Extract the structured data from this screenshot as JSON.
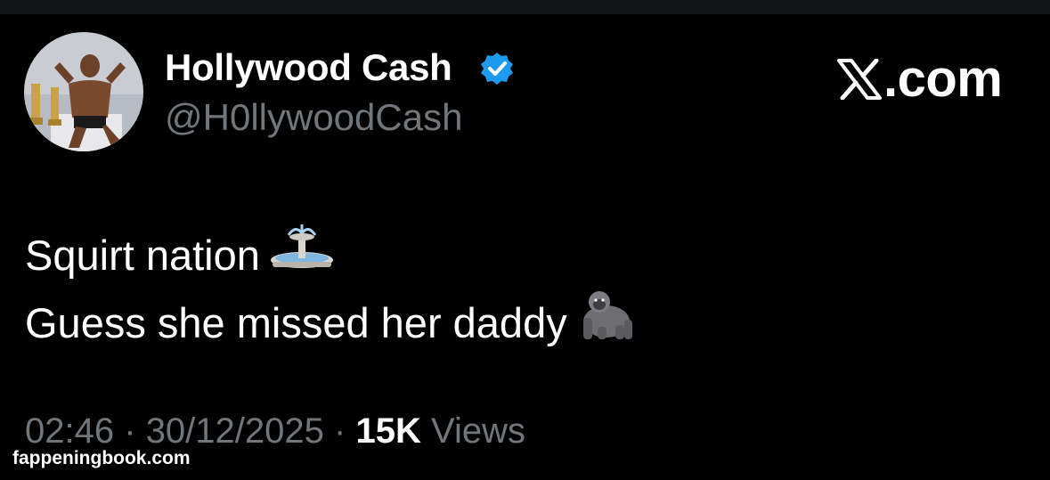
{
  "profile": {
    "display_name": "Hollywood Cash",
    "handle": "@H0llywoodCash",
    "verified": true,
    "verified_icon": "verified-badge-icon",
    "verified_color": "#1d9bf0"
  },
  "brand": {
    "logo_icon": "x-logo-icon",
    "text": ".com"
  },
  "tweet": {
    "lines": [
      {
        "text": "Squirt nation",
        "emoji": "fountain-emoji"
      },
      {
        "text": "Guess she missed her daddy",
        "emoji": "gorilla-emoji"
      }
    ]
  },
  "meta": {
    "time": "02:46",
    "separator": "·",
    "date": "30/12/2025",
    "views_count": "15K",
    "views_label": "Views"
  },
  "watermark": {
    "text": "fappeningbook.com"
  },
  "colors": {
    "background": "#000000",
    "text_primary": "#ffffff",
    "text_secondary": "#71767b"
  }
}
